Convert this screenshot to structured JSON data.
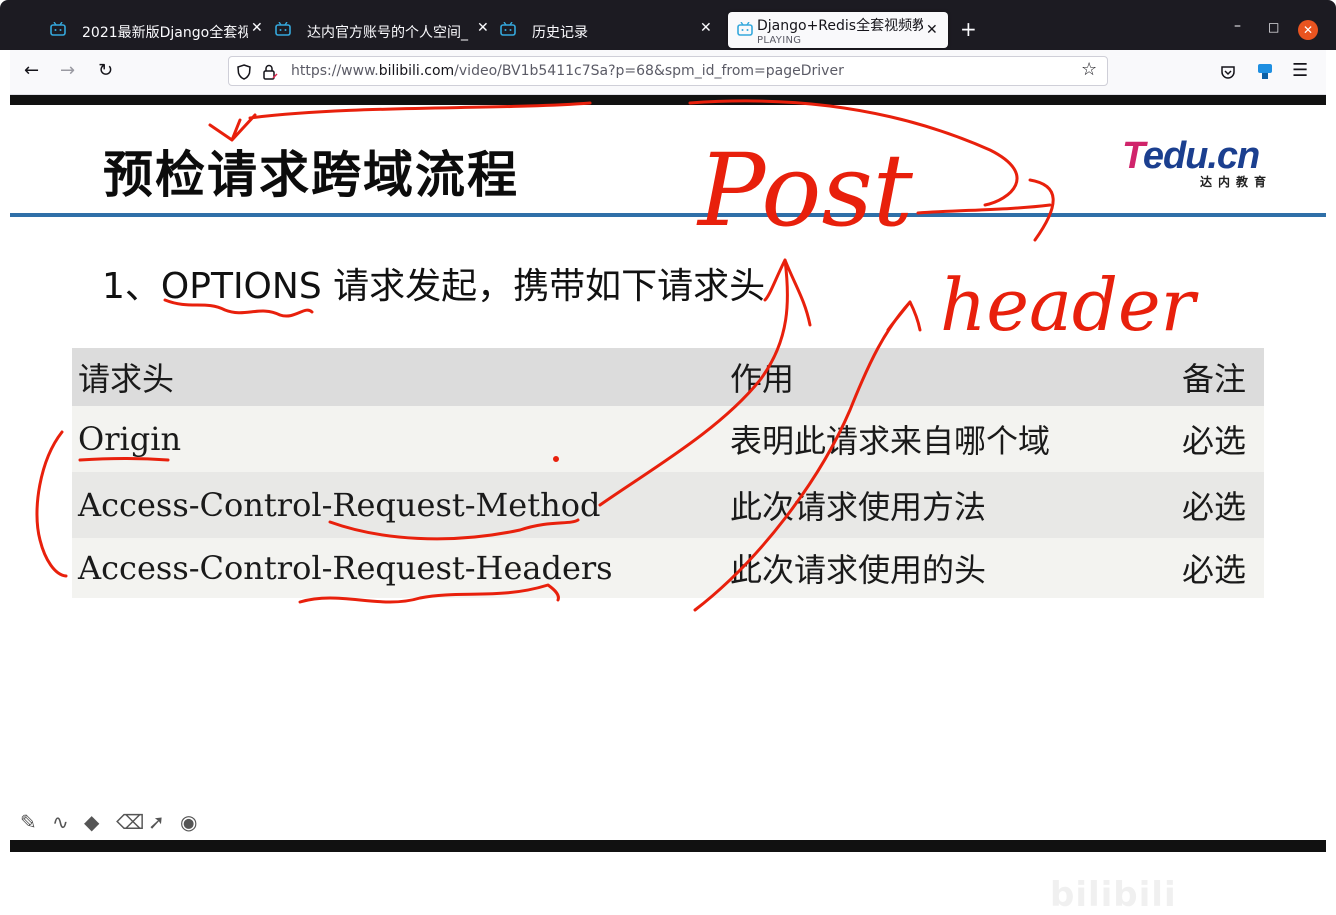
{
  "tabs": [
    {
      "title": "2021最新版Django全套视"
    },
    {
      "title": "达内官方账号的个人空间_"
    },
    {
      "title": "历史记录"
    },
    {
      "title": "Django+Redis全套视频教",
      "subtitle": "PLAYING"
    }
  ],
  "url": {
    "pre": "https://www.",
    "domain": "bilibili.com",
    "path": "/video/BV1b5411c7Sa?p=68&spm_id_from=pageDriver"
  },
  "slide": {
    "title": "预检请求跨域流程",
    "logo": "Tedu.cn",
    "logo_sub": "达内教育",
    "point": "1、OPTIONS 请求发起，携带如下请求头",
    "table": {
      "headers": [
        "请求头",
        "作用",
        "备注"
      ],
      "rows": [
        [
          "Origin",
          "表明此请求来自哪个域",
          "必选"
        ],
        [
          "Access-Control-Request-Method",
          "此次请求使用方法",
          "必选"
        ],
        [
          "Access-Control-Request-Headers",
          "此次请求使用的头",
          "必选"
        ]
      ]
    }
  },
  "annotations": {
    "post": "Post",
    "header": "header"
  },
  "watermark": "bilibili",
  "colors": {
    "accent_rule": "#2f6fa8",
    "ink": "#e8200c",
    "close_button": "#e95420"
  }
}
